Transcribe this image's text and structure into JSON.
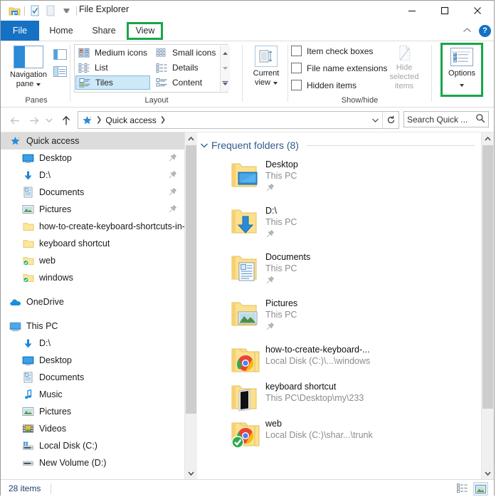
{
  "window": {
    "title": "File Explorer",
    "qat": [
      {
        "name": "folder-icon",
        "tip": "File Explorer"
      },
      {
        "name": "properties-icon",
        "tip": "Properties"
      },
      {
        "name": "new-folder-icon",
        "tip": "New folder"
      },
      {
        "name": "customize-qat-chevron-icon",
        "tip": "Customize Quick Access Toolbar"
      }
    ],
    "controls": {
      "minimize": "—",
      "maximize": "□",
      "close": "✕"
    }
  },
  "tabs": [
    {
      "label": "File",
      "active": false,
      "highlight": false
    },
    {
      "label": "Home",
      "active": false,
      "highlight": false
    },
    {
      "label": "Share",
      "active": false,
      "highlight": false
    },
    {
      "label": "View",
      "active": true,
      "highlight": true
    }
  ],
  "tab_extras": {
    "collapse_ribbon": "collapse-ribbon-chevron-icon",
    "help": "?"
  },
  "ribbon": {
    "groups": [
      {
        "name": "panes",
        "label": "Panes"
      },
      {
        "name": "layout",
        "label": "Layout"
      },
      {
        "name": "current_view",
        "label": ""
      },
      {
        "name": "show_hide",
        "label": "Show/hide"
      },
      {
        "name": "options",
        "label": ""
      }
    ],
    "panes": {
      "navigation_pane_label_line1": "Navigation",
      "navigation_pane_label_line2": "pane",
      "preview_pane_tip": "Preview pane",
      "details_pane_tip": "Details pane",
      "group_label": "Panes"
    },
    "layout": {
      "group_label": "Layout",
      "items": [
        {
          "label": "Medium icons",
          "selected": false
        },
        {
          "label": "List",
          "selected": false
        },
        {
          "label": "Tiles",
          "selected": true
        },
        {
          "label": "Small icons",
          "selected": false
        },
        {
          "label": "Details",
          "selected": false
        },
        {
          "label": "Content",
          "selected": false
        }
      ],
      "scroll": [
        "scroll-up-icon",
        "scroll-down-icon",
        "more-icon"
      ]
    },
    "current_view": {
      "label_line1": "Current",
      "label_line2": "view"
    },
    "show_hide": {
      "group_label": "Show/hide",
      "checkboxes": [
        {
          "label": "Item check boxes",
          "checked": false
        },
        {
          "label": "File name extensions",
          "checked": false
        },
        {
          "label": "Hidden items",
          "checked": false
        }
      ],
      "hide_selected_line1": "Hide selected",
      "hide_selected_line2": "items",
      "hide_selected_disabled": true
    },
    "options": {
      "label": "Options",
      "highlighted": true
    }
  },
  "address": {
    "back_icon": "back-arrow-icon",
    "forward_icon": "forward-arrow-icon",
    "recent_icon": "recent-locations-chevron-icon",
    "up_icon": "up-arrow-icon",
    "crumbs": [
      "Quick access"
    ],
    "dropdown_icon": "address-dropdown-chevron-icon",
    "refresh_icon": "refresh-icon",
    "search_placeholder": "Search Quick ...",
    "search_icon": "search-icon"
  },
  "sidebar": {
    "items": [
      {
        "label": "Quick access",
        "icon": "star-icon",
        "indent": 0,
        "selected": true,
        "pinned": false
      },
      {
        "label": "Desktop",
        "icon": "desktop-icon",
        "indent": 1,
        "selected": false,
        "pinned": true
      },
      {
        "label": "D:\\",
        "icon": "download-arrow-icon",
        "indent": 1,
        "selected": false,
        "pinned": true
      },
      {
        "label": "Documents",
        "icon": "documents-icon",
        "indent": 1,
        "selected": false,
        "pinned": true
      },
      {
        "label": "Pictures",
        "icon": "pictures-icon",
        "indent": 1,
        "selected": false,
        "pinned": true
      },
      {
        "label": "how-to-create-keyboard-shortcuts-in-w",
        "icon": "folder-icon",
        "indent": 1,
        "selected": false,
        "pinned": false
      },
      {
        "label": "keyboard shortcut",
        "icon": "folder-icon",
        "indent": 1,
        "selected": false,
        "pinned": false
      },
      {
        "label": "web",
        "icon": "folder-synced-icon",
        "indent": 1,
        "selected": false,
        "pinned": false
      },
      {
        "label": "windows",
        "icon": "folder-synced-icon",
        "indent": 1,
        "selected": false,
        "pinned": false
      },
      {
        "label": "OneDrive",
        "icon": "onedrive-cloud-icon",
        "indent": 0,
        "selected": false,
        "pinned": false
      },
      {
        "label": "This PC",
        "icon": "this-pc-icon",
        "indent": 0,
        "selected": false,
        "pinned": false
      },
      {
        "label": "D:\\",
        "icon": "download-arrow-icon",
        "indent": 1,
        "selected": false,
        "pinned": false
      },
      {
        "label": "Desktop",
        "icon": "desktop-icon",
        "indent": 1,
        "selected": false,
        "pinned": false
      },
      {
        "label": "Documents",
        "icon": "documents-icon",
        "indent": 1,
        "selected": false,
        "pinned": false
      },
      {
        "label": "Music",
        "icon": "music-note-icon",
        "indent": 1,
        "selected": false,
        "pinned": false
      },
      {
        "label": "Pictures",
        "icon": "pictures-icon",
        "indent": 1,
        "selected": false,
        "pinned": false
      },
      {
        "label": "Videos",
        "icon": "videos-icon",
        "indent": 1,
        "selected": false,
        "pinned": false
      },
      {
        "label": "Local Disk (C:)",
        "icon": "local-disk-icon",
        "indent": 1,
        "selected": false,
        "pinned": false
      },
      {
        "label": "New Volume (D:)",
        "icon": "drive-icon",
        "indent": 1,
        "selected": false,
        "pinned": false
      }
    ]
  },
  "content": {
    "group_title": "Frequent folders (8)",
    "group_chevron": "chevron-down-icon",
    "tiles": [
      {
        "name": "Desktop",
        "sub": "This PC",
        "icon": "folder-desktop-icon",
        "pinned": true
      },
      {
        "name": "D:\\",
        "sub": "This PC",
        "icon": "folder-download-icon",
        "pinned": true
      },
      {
        "name": "Documents",
        "sub": "This PC",
        "icon": "folder-documents-icon",
        "pinned": true
      },
      {
        "name": "Pictures",
        "sub": "This PC",
        "icon": "folder-pictures-icon",
        "pinned": true
      },
      {
        "name": "how-to-create-keyboard-...",
        "sub": "Local Disk (C:)\\...\\windows",
        "icon": "folder-chrome-icon",
        "pinned": false
      },
      {
        "name": "keyboard shortcut",
        "sub": "This PC\\Desktop\\my\\233",
        "icon": "folder-book-icon",
        "pinned": false
      },
      {
        "name": "web",
        "sub": "Local Disk (C:)\\shar...\\trunk",
        "icon": "folder-chrome-synced-icon",
        "pinned": false
      }
    ]
  },
  "statusbar": {
    "item_count": "28 items",
    "views": [
      {
        "name": "details-view-button",
        "active": false
      },
      {
        "name": "large-icons-view-button",
        "active": true
      }
    ]
  },
  "colors": {
    "accent": "#1471c4",
    "highlight_green": "#18a64a",
    "selection": "#dcdcdc",
    "tile_selected": "#cde8f7",
    "group_title": "#2f5a8c"
  }
}
